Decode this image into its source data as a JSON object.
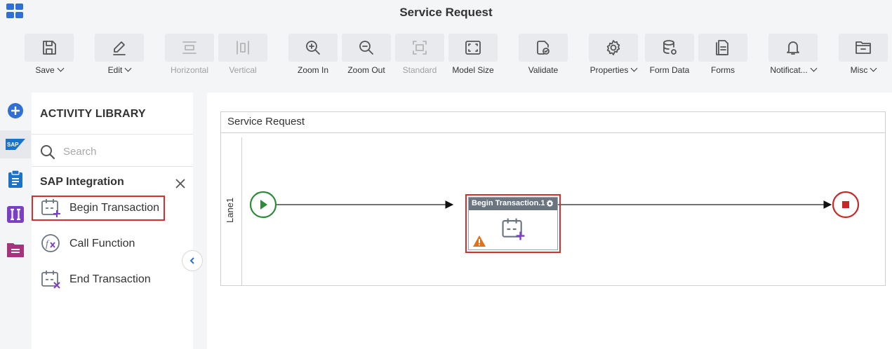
{
  "app": {
    "title": "Service Request"
  },
  "toolbar": {
    "save": "Save",
    "edit": "Edit",
    "horizontal": "Horizontal",
    "vertical": "Vertical",
    "zoom_in": "Zoom In",
    "zoom_out": "Zoom Out",
    "standard": "Standard",
    "model_size": "Model Size",
    "validate": "Validate",
    "properties": "Properties",
    "form_data": "Form Data",
    "forms": "Forms",
    "notifications": "Notificat...",
    "misc": "Misc"
  },
  "library": {
    "title": "ACTIVITY LIBRARY",
    "search_placeholder": "Search",
    "group": "SAP Integration",
    "items": [
      {
        "label": "Begin Transaction",
        "icon": "calendar-plus-icon"
      },
      {
        "label": "Call Function",
        "icon": "function-icon"
      },
      {
        "label": "End Transaction",
        "icon": "calendar-x-icon"
      }
    ]
  },
  "rail": {
    "sap_label": "SAP"
  },
  "canvas": {
    "pool_title": "Service Request",
    "lane": "Lane1",
    "task_title": "Begin Transaction.1"
  },
  "colors": {
    "accent": "#2f6fd6",
    "selected_border": "#d32f2f",
    "start_event": "#2e8b3a",
    "end_event": "#c62828",
    "warning": "#e0701a",
    "purple": "#7b3fc4",
    "magenta": "#a8327e"
  }
}
